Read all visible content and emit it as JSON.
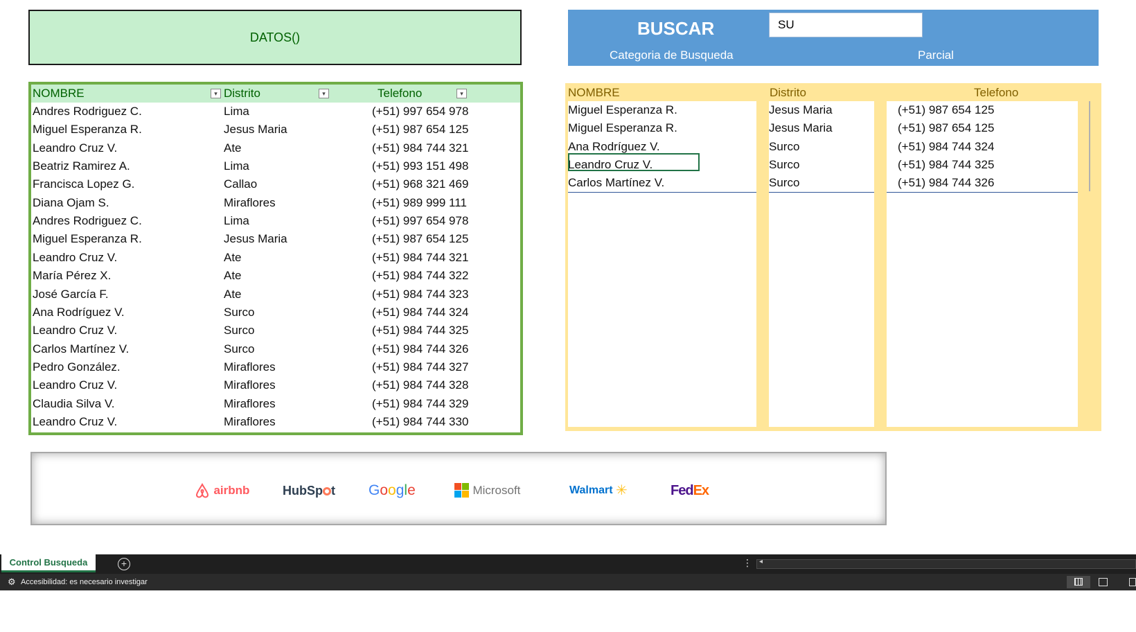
{
  "datos_box": {
    "title": "DATOS()"
  },
  "data_table": {
    "headers": [
      "NOMBRE",
      "Distrito",
      "Telefono"
    ],
    "rows": [
      [
        "Andres Rodriguez C.",
        "Lima",
        "(+51) 997 654 978"
      ],
      [
        "Miguel Esperanza R.",
        "Jesus Maria",
        "(+51) 987 654 125"
      ],
      [
        "Leandro Cruz V.",
        "Ate",
        "(+51) 984 744 321"
      ],
      [
        "Beatriz Ramirez A.",
        "Lima",
        "(+51) 993 151 498"
      ],
      [
        "Francisca Lopez G.",
        "Callao",
        "(+51) 968 321 469"
      ],
      [
        "Diana Ojam S.",
        "Miraflores",
        "(+51) 989 999 111"
      ],
      [
        "Andres Rodriguez C.",
        "Lima",
        "(+51) 997 654 978"
      ],
      [
        "Miguel Esperanza R.",
        "Jesus Maria",
        "(+51) 987 654 125"
      ],
      [
        "Leandro Cruz V.",
        "Ate",
        "(+51) 984 744 321"
      ],
      [
        "María Pérez X.",
        "Ate",
        "(+51) 984 744 322"
      ],
      [
        "José García F.",
        "Ate",
        "(+51) 984 744 323"
      ],
      [
        "Ana Rodríguez V.",
        "Surco",
        "(+51) 984 744 324"
      ],
      [
        "Leandro Cruz V.",
        "Surco",
        "(+51) 984 744 325"
      ],
      [
        "Carlos Martínez V.",
        "Surco",
        "(+51) 984 744 326"
      ],
      [
        "Pedro González.",
        "Miraflores",
        "(+51) 984 744 327"
      ],
      [
        "Leandro Cruz V.",
        "Miraflores",
        "(+51) 984 744 328"
      ],
      [
        "Claudia Silva V.",
        "Miraflores",
        "(+51) 984 744 329"
      ],
      [
        "Leandro Cruz V.",
        "Miraflores",
        "(+51) 984 744 330"
      ]
    ]
  },
  "buscar": {
    "title": "BUSCAR",
    "search_value": "SU",
    "categoria_label": "Categoria de Busqueda",
    "parcial_label": "Parcial"
  },
  "results": {
    "headers": [
      "NOMBRE",
      "Distrito",
      "Telefono"
    ],
    "names": [
      "Miguel Esperanza R.",
      "Miguel Esperanza R.",
      "Ana Rodríguez V.",
      "Leandro Cruz V.",
      "Carlos Martínez V."
    ],
    "districts": [
      "Jesus Maria",
      "Jesus Maria",
      "Surco",
      "Surco",
      "Surco"
    ],
    "phones": [
      "(+51) 987 654 125",
      "(+51) 987 654 125",
      "(+51) 984 744 324",
      "(+51) 984 744 325",
      "(+51) 984 744 326"
    ]
  },
  "logos": {
    "airbnb": "airbnb",
    "hubspot_a": "HubSp",
    "hubspot_b": "t",
    "google": [
      "G",
      "o",
      "o",
      "g",
      "l",
      "e"
    ],
    "microsoft": "Microsoft",
    "walmart": "Walmart",
    "fedex_a": "Fed",
    "fedex_b": "Ex",
    "colors": {
      "airbnb": "#ff5a5f",
      "hubspot": "#2d3e50",
      "hubspot_accent": "#ff7a59",
      "google": [
        "#4285f4",
        "#ea4335",
        "#fbbc05",
        "#4285f4",
        "#34a853",
        "#ea4335"
      ],
      "microsoft": [
        "#f25022",
        "#7fba00",
        "#00a4ef",
        "#ffb900"
      ],
      "walmart": "#0071ce",
      "walmart_spark": "#ffc220",
      "fedex_purple": "#4d148c",
      "fedex_orange": "#ff6600"
    }
  },
  "sheet_bar": {
    "tab_label": "Control Busqueda",
    "add_icon": "+"
  },
  "status_bar": {
    "text": "Accesibilidad: es necesario investigar"
  },
  "colors": {
    "green_accent": "#70ad47",
    "green_header": "#c6efce",
    "blue_panel": "#5b9bd5",
    "yellow_panel": "#ffe699",
    "excel_green": "#217346"
  }
}
